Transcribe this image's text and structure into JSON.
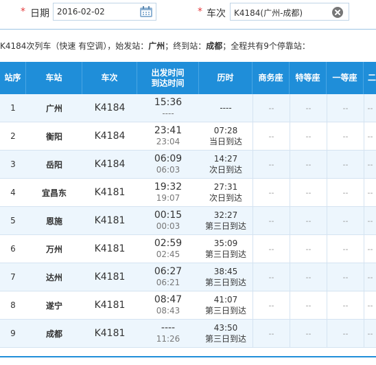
{
  "search": {
    "required_mark": "*",
    "date_label": "日期",
    "date_value": "2016-02-02",
    "train_label": "车次",
    "train_value": "K4184(广州-成都)"
  },
  "info": {
    "train": "K4184",
    "text1": "次列车（快速 有空调），始发站：",
    "origin": "广州",
    "text2": "；终到站：",
    "dest": "成都",
    "text3": "；全程共有9个停靠站："
  },
  "table": {
    "headers": {
      "no": "站序",
      "station": "车站",
      "train": "车次",
      "time_line1": "出发时间",
      "time_line2": "到达时间",
      "duration": "历时",
      "business": "商务座",
      "special": "特等座",
      "first": "一等座",
      "second": "二"
    },
    "seat_placeholder": "--",
    "rows": [
      {
        "no": "1",
        "station": "广州",
        "train": "K4184",
        "dep": "15:36",
        "arr": "----",
        "dur": "----",
        "dur_note": ""
      },
      {
        "no": "2",
        "station": "衡阳",
        "train": "K4184",
        "dep": "23:41",
        "arr": "23:04",
        "dur": "07:28",
        "dur_note": "当日到达"
      },
      {
        "no": "3",
        "station": "岳阳",
        "train": "K4184",
        "dep": "06:09",
        "arr": "06:03",
        "dur": "14:27",
        "dur_note": "次日到达"
      },
      {
        "no": "4",
        "station": "宜昌东",
        "train": "K4181",
        "dep": "19:32",
        "arr": "19:07",
        "dur": "27:31",
        "dur_note": "次日到达"
      },
      {
        "no": "5",
        "station": "恩施",
        "train": "K4181",
        "dep": "00:15",
        "arr": "00:03",
        "dur": "32:27",
        "dur_note": "第三日到达"
      },
      {
        "no": "6",
        "station": "万州",
        "train": "K4181",
        "dep": "02:59",
        "arr": "02:45",
        "dur": "35:09",
        "dur_note": "第三日到达"
      },
      {
        "no": "7",
        "station": "达州",
        "train": "K4181",
        "dep": "06:27",
        "arr": "06:21",
        "dur": "38:45",
        "dur_note": "第三日到达"
      },
      {
        "no": "8",
        "station": "遂宁",
        "train": "K4181",
        "dep": "08:47",
        "arr": "08:43",
        "dur": "41:07",
        "dur_note": "第三日到达"
      },
      {
        "no": "9",
        "station": "成都",
        "train": "K4181",
        "dep": "----",
        "arr": "11:26",
        "dur": "43:50",
        "dur_note": "第三日到达"
      }
    ]
  }
}
